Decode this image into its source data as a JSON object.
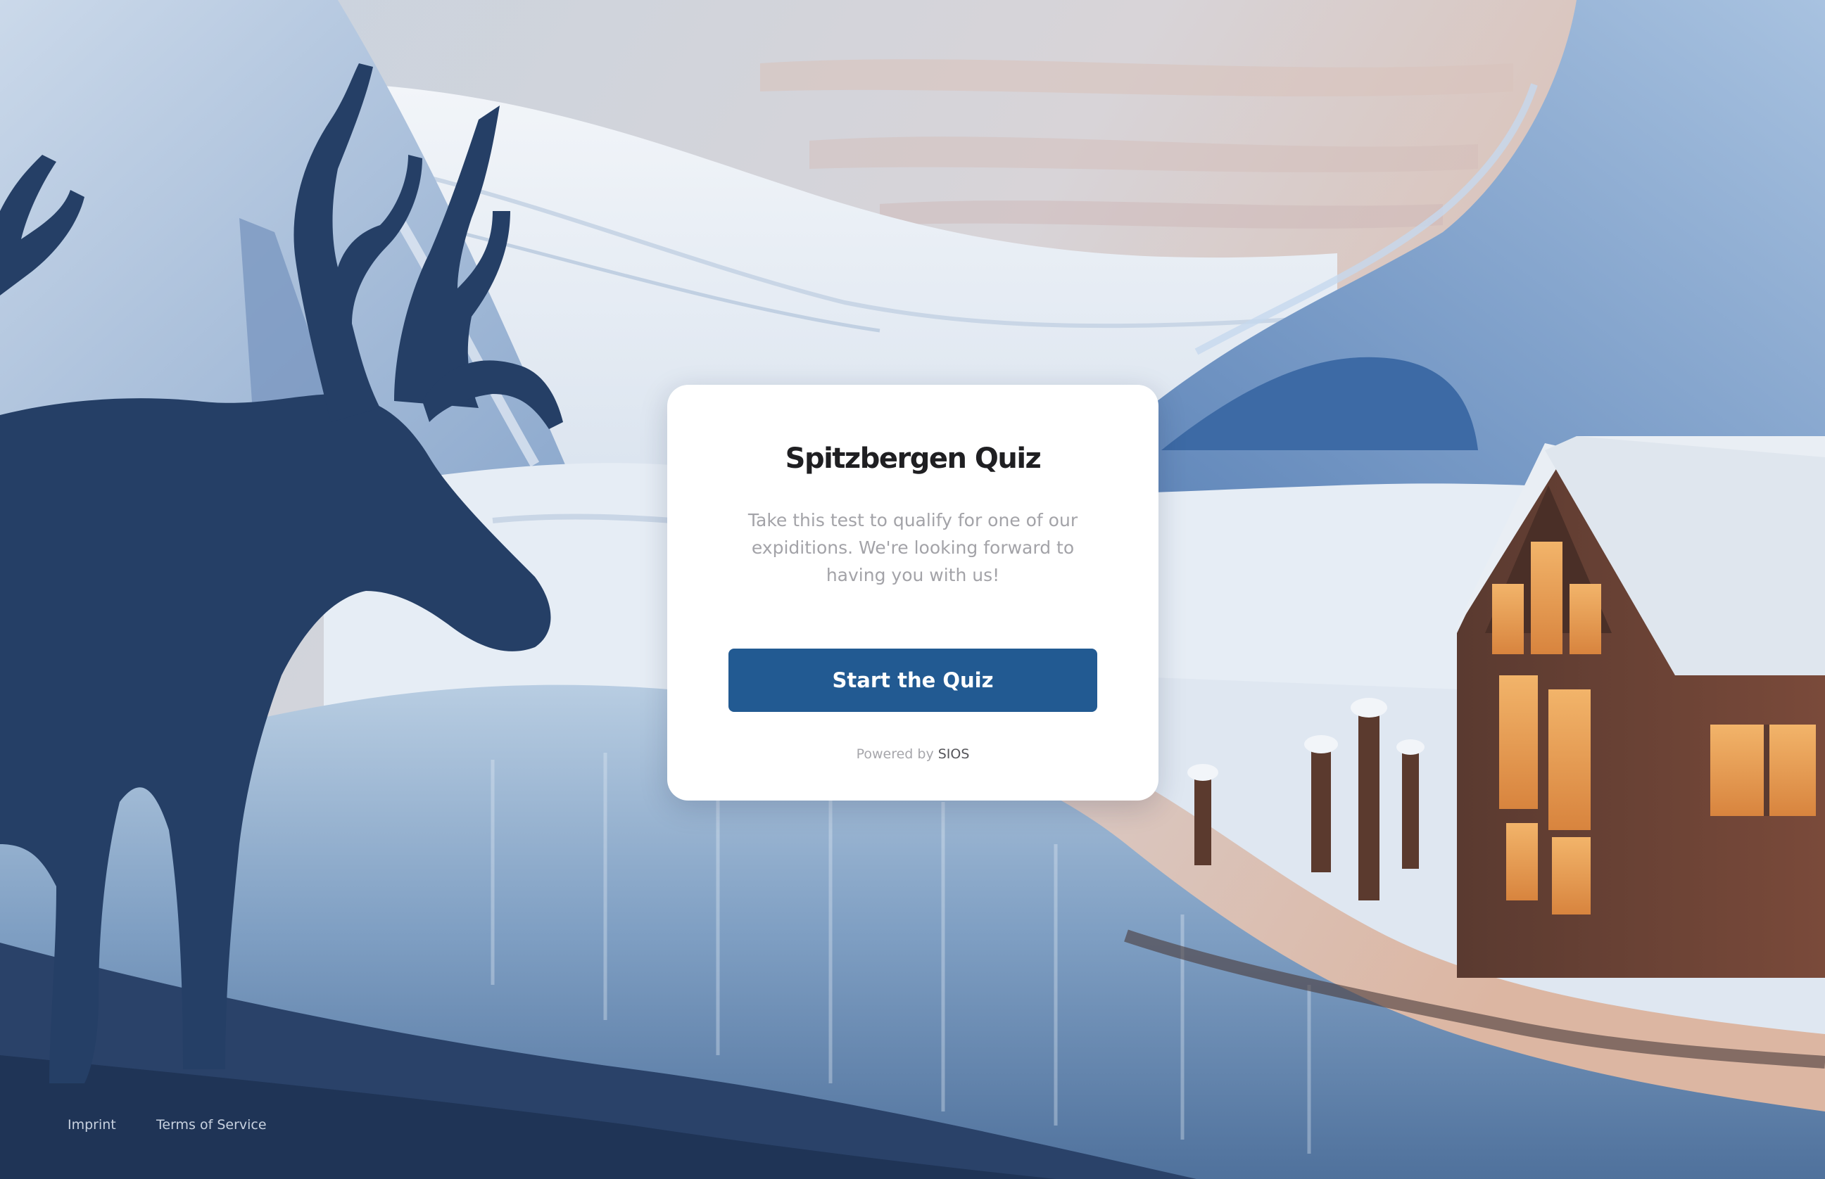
{
  "quiz": {
    "title": "Spitzbergen Quiz",
    "description": "Take this test to qualify for one of our\nexpiditions. We're looking  forward to\nhaving you with us!",
    "start_label": "Start the Quiz",
    "powered_prefix": "Powered by",
    "powered_brand": "SIOS"
  },
  "footer": {
    "imprint_label": "Imprint",
    "terms_label": "Terms of Service"
  },
  "colors": {
    "button": "#225a92",
    "title": "#1f1f22",
    "description": "#a3a3a8"
  },
  "icons": [
    "reindeer-illustration",
    "cabin-illustration"
  ]
}
